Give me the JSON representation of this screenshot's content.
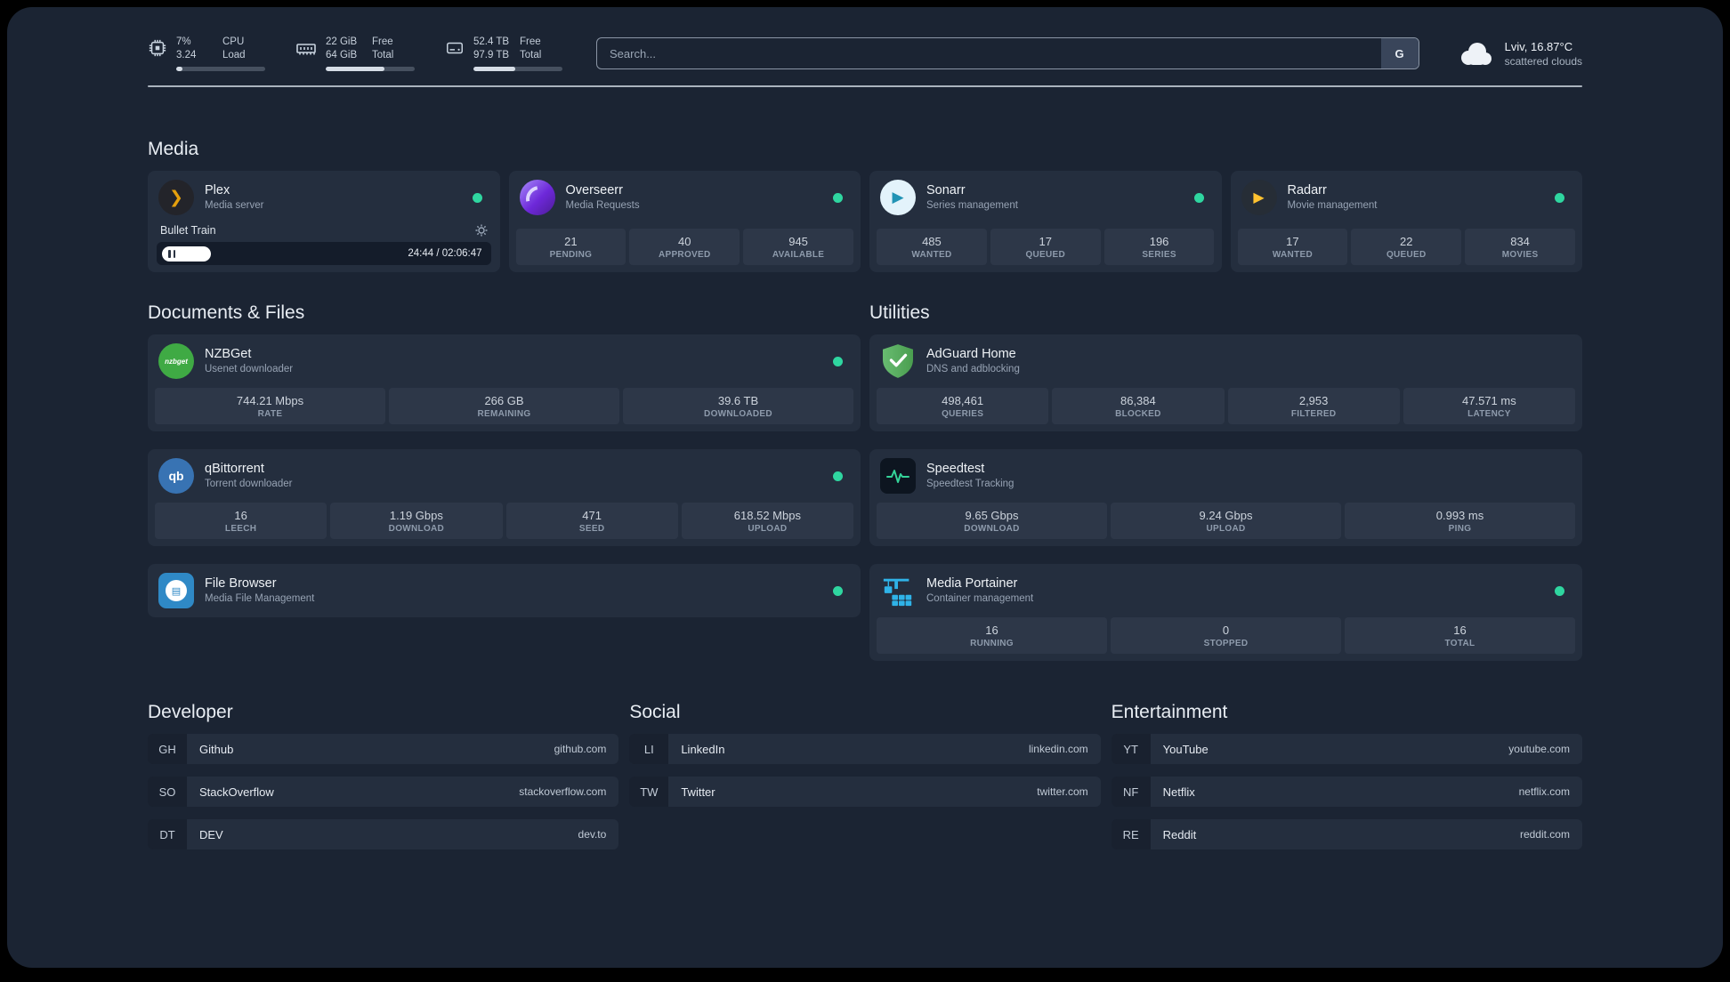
{
  "topbar": {
    "cpu": {
      "value_top": "7%",
      "label_top": "CPU",
      "value_bottom": "3.24",
      "label_bottom": "Load",
      "bar_percent": 7
    },
    "ram": {
      "value_top": "22 GiB",
      "label_top": "Free",
      "value_bottom": "64 GiB",
      "label_bottom": "Total",
      "bar_percent": 66
    },
    "disk": {
      "value_top": "52.4 TB",
      "label_top": "Free",
      "value_bottom": "97.9 TB",
      "label_bottom": "Total",
      "bar_percent": 47
    },
    "search": {
      "placeholder": "Search...",
      "provider_label": "G"
    },
    "weather": {
      "location": "Lviv, 16.87°C",
      "condition": "scattered clouds"
    }
  },
  "groups": {
    "media": {
      "title": "Media",
      "plex": {
        "name": "Plex",
        "desc": "Media server",
        "status": "online",
        "track": "Bullet Train",
        "time": "24:44 / 02:06:47",
        "progress_percent": 15
      },
      "overseerr": {
        "name": "Overseerr",
        "desc": "Media Requests",
        "status": "online",
        "stats": [
          {
            "value": "21",
            "label": "PENDING"
          },
          {
            "value": "40",
            "label": "APPROVED"
          },
          {
            "value": "945",
            "label": "AVAILABLE"
          }
        ]
      },
      "sonarr": {
        "name": "Sonarr",
        "desc": "Series management",
        "status": "online",
        "stats": [
          {
            "value": "485",
            "label": "WANTED"
          },
          {
            "value": "17",
            "label": "QUEUED"
          },
          {
            "value": "196",
            "label": "SERIES"
          }
        ]
      },
      "radarr": {
        "name": "Radarr",
        "desc": "Movie management",
        "status": "online",
        "stats": [
          {
            "value": "17",
            "label": "WANTED"
          },
          {
            "value": "22",
            "label": "QUEUED"
          },
          {
            "value": "834",
            "label": "MOVIES"
          }
        ]
      }
    },
    "documents": {
      "title": "Documents & Files",
      "nzbget": {
        "name": "NZBGet",
        "desc": "Usenet downloader",
        "status": "online",
        "icon_text": "nzbget",
        "stats": [
          {
            "value": "744.21 Mbps",
            "label": "RATE"
          },
          {
            "value": "266 GB",
            "label": "REMAINING"
          },
          {
            "value": "39.6 TB",
            "label": "DOWNLOADED"
          }
        ]
      },
      "qbittorrent": {
        "name": "qBittorrent",
        "desc": "Torrent downloader",
        "status": "online",
        "icon_text": "qb",
        "stats": [
          {
            "value": "16",
            "label": "LEECH"
          },
          {
            "value": "1.19 Gbps",
            "label": "DOWNLOAD"
          },
          {
            "value": "471",
            "label": "SEED"
          },
          {
            "value": "618.52 Mbps",
            "label": "UPLOAD"
          }
        ]
      },
      "filebrowser": {
        "name": "File Browser",
        "desc": "Media File Management",
        "status": "online"
      }
    },
    "utilities": {
      "title": "Utilities",
      "adguard": {
        "name": "AdGuard Home",
        "desc": "DNS and adblocking",
        "stats": [
          {
            "value": "498,461",
            "label": "QUERIES"
          },
          {
            "value": "86,384",
            "label": "BLOCKED"
          },
          {
            "value": "2,953",
            "label": "FILTERED"
          },
          {
            "value": "47.571 ms",
            "label": "LATENCY"
          }
        ]
      },
      "speedtest": {
        "name": "Speedtest",
        "desc": "Speedtest Tracking",
        "stats": [
          {
            "value": "9.65 Gbps",
            "label": "DOWNLOAD"
          },
          {
            "value": "9.24 Gbps",
            "label": "UPLOAD"
          },
          {
            "value": "0.993 ms",
            "label": "PING"
          }
        ]
      },
      "portainer": {
        "name": "Media Portainer",
        "desc": "Container management",
        "status": "online",
        "stats": [
          {
            "value": "16",
            "label": "RUNNING"
          },
          {
            "value": "0",
            "label": "STOPPED"
          },
          {
            "value": "16",
            "label": "TOTAL"
          }
        ]
      }
    }
  },
  "bookmarks": {
    "developer": {
      "title": "Developer",
      "items": [
        {
          "abbr": "GH",
          "name": "Github",
          "domain": "github.com"
        },
        {
          "abbr": "SO",
          "name": "StackOverflow",
          "domain": "stackoverflow.com"
        },
        {
          "abbr": "DT",
          "name": "DEV",
          "domain": "dev.to"
        }
      ]
    },
    "social": {
      "title": "Social",
      "items": [
        {
          "abbr": "LI",
          "name": "LinkedIn",
          "domain": "linkedin.com"
        },
        {
          "abbr": "TW",
          "name": "Twitter",
          "domain": "twitter.com"
        }
      ]
    },
    "entertainment": {
      "title": "Entertainment",
      "items": [
        {
          "abbr": "YT",
          "name": "YouTube",
          "domain": "youtube.com"
        },
        {
          "abbr": "NF",
          "name": "Netflix",
          "domain": "netflix.com"
        },
        {
          "abbr": "RE",
          "name": "Reddit",
          "domain": "reddit.com"
        }
      ]
    }
  },
  "colors": {
    "status_online": "#2fd6a0",
    "plex_accent": "#e5a00d",
    "background": "#1b2433",
    "card": "#242e3e"
  }
}
